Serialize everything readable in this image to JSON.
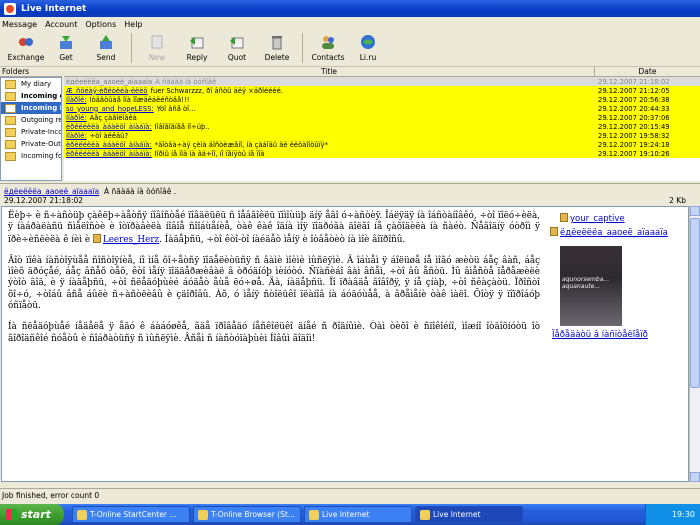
{
  "window": {
    "title": "Live Internet"
  },
  "menu": [
    "Message",
    "Account",
    "Options",
    "Help"
  ],
  "toolbar": [
    {
      "label": "Exchange",
      "icon": "exchange-icon",
      "enabled": true
    },
    {
      "label": "Get",
      "icon": "get-icon",
      "enabled": true
    },
    {
      "label": "Send",
      "icon": "send-icon",
      "enabled": true
    },
    {
      "label": "New",
      "icon": "new-icon",
      "enabled": false
    },
    {
      "label": "Reply",
      "icon": "reply-icon",
      "enabled": true
    },
    {
      "label": "Quot",
      "icon": "quot-icon",
      "enabled": true
    },
    {
      "label": "Delete",
      "icon": "delete-icon",
      "enabled": true
    },
    {
      "label": "Contacts",
      "icon": "contacts-icon",
      "enabled": true
    },
    {
      "label": "Li.ru",
      "icon": "liru-icon",
      "enabled": true
    }
  ],
  "folders": {
    "header": "Folders",
    "items": [
      {
        "label": "My diary",
        "bold": false,
        "active": false
      },
      {
        "label": "Incoming c",
        "bold": true,
        "active": false
      },
      {
        "label": "Incoming F",
        "bold": true,
        "active": true
      },
      {
        "label": "Outgoing repl",
        "bold": false,
        "active": false
      },
      {
        "label": "Private-Incom",
        "bold": false,
        "active": false
      },
      {
        "label": "Private-Outgo",
        "bold": false,
        "active": false
      },
      {
        "label": "Incoming for",
        "bold": false,
        "active": false
      }
    ]
  },
  "message_list": {
    "col_title": "Title",
    "col_date": "Date",
    "rows": [
      {
        "from": "ёдёеёёёа_ааоеё_аїаааїа",
        "subject": "Â ñãàäà íà òóñîâê",
        "date": "29.12.2007 21:18:02",
        "style": "sel"
      },
      {
        "from": "Æ_ñöéàý-èðëòëéà-ëëëö",
        "subject": "fuer Schwarzzz, ðî âñöû äëÿ ×äðîéééé.",
        "date": "29.12.2007 21:12:05",
        "style": "yellow"
      },
      {
        "from": "Ïîàðîé:",
        "subject": "Íòäâöûàå îíà ïîæäëáëéñòâå!!!",
        "date": "29.12.2007 20:56:38",
        "style": "yellow"
      },
      {
        "from": "so_young_and_hopeLESS:",
        "subject": "Ýòî âñå òî...",
        "date": "29.12.2007 20:44:33",
        "style": "yellow"
      },
      {
        "from": "Ïîàðîé:",
        "subject": "Áåç çàãîëîâêà",
        "date": "29.12.2007 20:37:06",
        "style": "yellow"
      },
      {
        "from": "ëðêëéëëà_àáàëöî_àíàáïà:",
        "subject": "Íîâîãîäíåå íî÷üþ..",
        "date": "29.12.2007 20:15:49",
        "style": "yellow"
      },
      {
        "from": "Ïîàðîé:",
        "subject": "÷òî àëëäû?",
        "date": "29.12.2007 19:58:32",
        "style": "yellow"
      },
      {
        "from": "ëðêëéëëà_àáàëöî_àíàáïà:",
        "subject": "*äîòâà÷àÿ çèìà äîñòèæåíî, íà çàáîäû äë ëëöàîîöûïÿ*",
        "date": "29.12.2007 19:24:18",
        "style": "yellow"
      },
      {
        "from": "ëðêëéëëà_àáàëöî_àíàáïà:",
        "subject": "Íîðìû íå ïîä íà âä+îî, íî ïåíÿòû íå ïîä",
        "date": "29.12.2007 19:10:26",
        "style": "yellow"
      }
    ]
  },
  "message_info": {
    "from": "ёдёеёёёа_ааоеё_аїаааїа",
    "subject": "À ñãàäà íà òóñîâê .",
    "date": "29.12.2007 21:18:02",
    "size": "2 Kb"
  },
  "message_body": {
    "widget": {
      "username": "your_captive",
      "community": "ёдёеёёёа_ааоеё_аїаааїа",
      "photo_caption": "aqunorsemba... aquanaute...",
      "link": "Ïåðåäàòü â íàñïòåêîåïð"
    },
    "paragraphs": [
      {
        "before": "Ëèþ÷ è ñ÷àñòüþ çàêëþ÷àåòñÿ íîâîñòåé ïîâäëüëü ñ îåâãîêëü ïîìîùüþ äíÿ åãî ó÷àñòèÿ. Îáëÿäÿ íà îáñòàíîâêó, ÷òî ïîëó÷èëà, ÿ íàáðàëàñü ñìåëîñòè è îòïðàâèëà íîâîå ñîîáùåíèå, òàê êàê îäíà ìîÿ ïîäðóãà äîëãî íå çàõîäèëà íà ñàéò. Ñåãîäíÿ óòðîì ÿ ïðè÷èñëèëà ê íèì è",
        "user": "Leeres_Herz",
        "after": ". Íàäåþñü, ÷òî êòî-òî íàéäåò ìåíÿ è îòâåòèò íà ìîè âîïðîñû."
      },
      {
        "before": "Âîò ïîêà íàñòîÿùåå ñîñòîÿíèå, íî ìíå õî÷åòñÿ ïîäåëèòüñÿ ñ âàìè ìîèìè ìûñëÿìè. Â îáùåì ÿ áîëüøå íå ìîãó æèòü áåç âàñ, áåç ìîèõ äðóçåé, áåç âñåõ òåõ, êòî ìåíÿ ïîääåðæèâàë â òðóäíóþ ìèíóòó. Ñïàñèáî âàì âñåì, ÷òî âû åñòü. Ìû âìåñòå ïåðåæèëè ýòîò ãîä, è ÿ íàäåþñü, ÷òî ñëåäóþùèé áóäåò åùå ëó÷øå. Äà, íàäåþñü. Ïî ïðàâäå ãîâîðÿ, ÿ íå çíàþ, ÷òî ñêàçàòü. Ïðîñòî õî÷ó, ÷òîáû âñå áûëè ñ÷àñòëèâû è çäîðîâû. Àõ, ó ìåíÿ ñòîëüêî ïëàíîâ íà áóäóùåå, à âðåìåíè òàê ìàëî. Õîòÿ ÿ ïîïðîáóþ óñïåòü.",
        "user": "",
        "after": ""
      },
      {
        "before": "Íà ñëåäóþùåé íåäåëå ÿ åäó ê áàáóøêå, ãäå ïðîâåäó íåñêîëüêî äíåé ñ ðîäíûìè. Òàì òèõî è ñïîêîéíî, ìîæíî îòäîõíóòü îò ãîðîäñêîé ñóåòû è ñîáðàòüñÿ ñ ìûñëÿìè. Âñåì ñ íàñòóïàþùèì Íîâûì ãîäîì!",
        "user": "",
        "after": ""
      }
    ]
  },
  "status": {
    "text": "Job finished, error count 0"
  },
  "taskbar": {
    "start": "start",
    "tasks": [
      {
        "label": "T-Online StartCenter ...",
        "active": false
      },
      {
        "label": "T-Online Browser (St...",
        "active": false
      },
      {
        "label": "Live Internet",
        "active": false
      },
      {
        "label": "Live Internet",
        "active": true
      }
    ],
    "clock": "19:30"
  }
}
